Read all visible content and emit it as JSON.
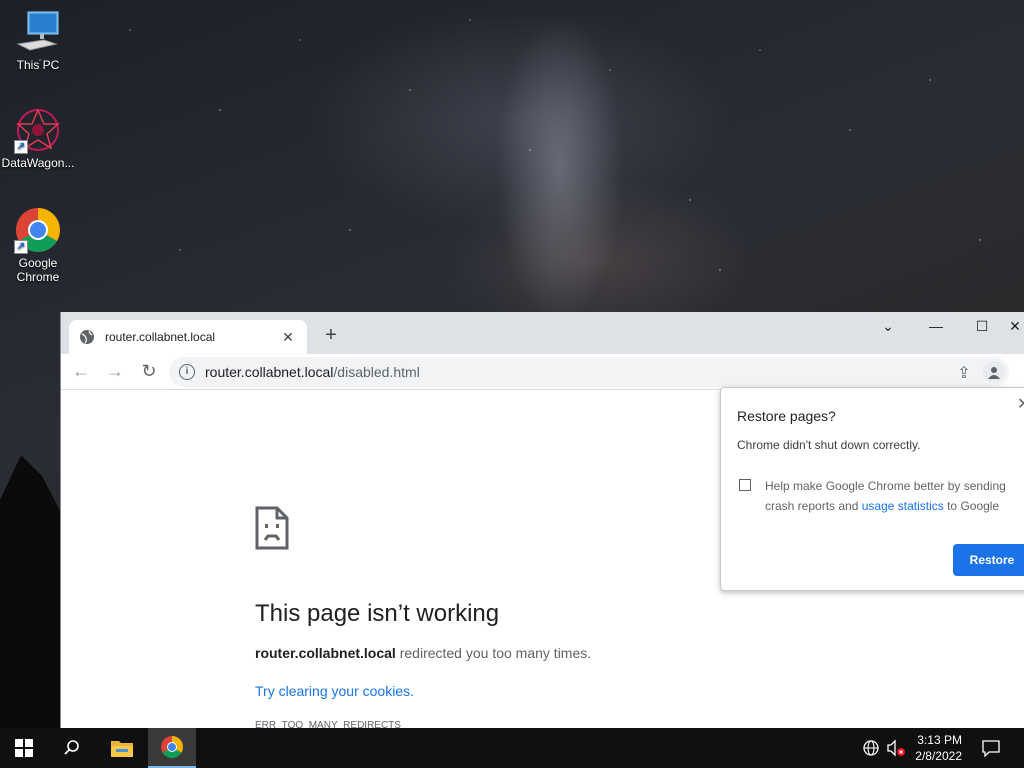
{
  "desktop": {
    "icons": [
      {
        "label": "This PC",
        "icon": "this-pc-icon"
      },
      {
        "label": "DataWagon...",
        "icon": "datawagon-icon"
      },
      {
        "label": "Google Chrome",
        "icon": "chrome-icon"
      }
    ]
  },
  "browser": {
    "tab_title": "router.collabnet.local",
    "url_host": "router.collabnet.local",
    "url_path": "/disabled.html",
    "window_controls": {
      "dropdown": "⌄",
      "minimize": "—",
      "maximize": "☐",
      "close": "✕"
    }
  },
  "error_page": {
    "title": "This page isn’t working",
    "host": "router.collabnet.local",
    "message": " redirected you too many times.",
    "link": "Try clearing your cookies.",
    "code": "ERR_TOO_MANY_REDIRECTS"
  },
  "restore_bubble": {
    "title": "Restore pages?",
    "subtitle": "Chrome didn't shut down correctly.",
    "checkbox_text_before": "Help make Google Chrome better by sending crash reports and ",
    "checkbox_link": "usage statistics",
    "checkbox_text_after": " to Google",
    "button": "Restore"
  },
  "taskbar": {
    "time": "3:13 PM",
    "date": "2/8/2022"
  },
  "colors": {
    "accent": "#1a73e8",
    "taskbar": "#101010"
  }
}
